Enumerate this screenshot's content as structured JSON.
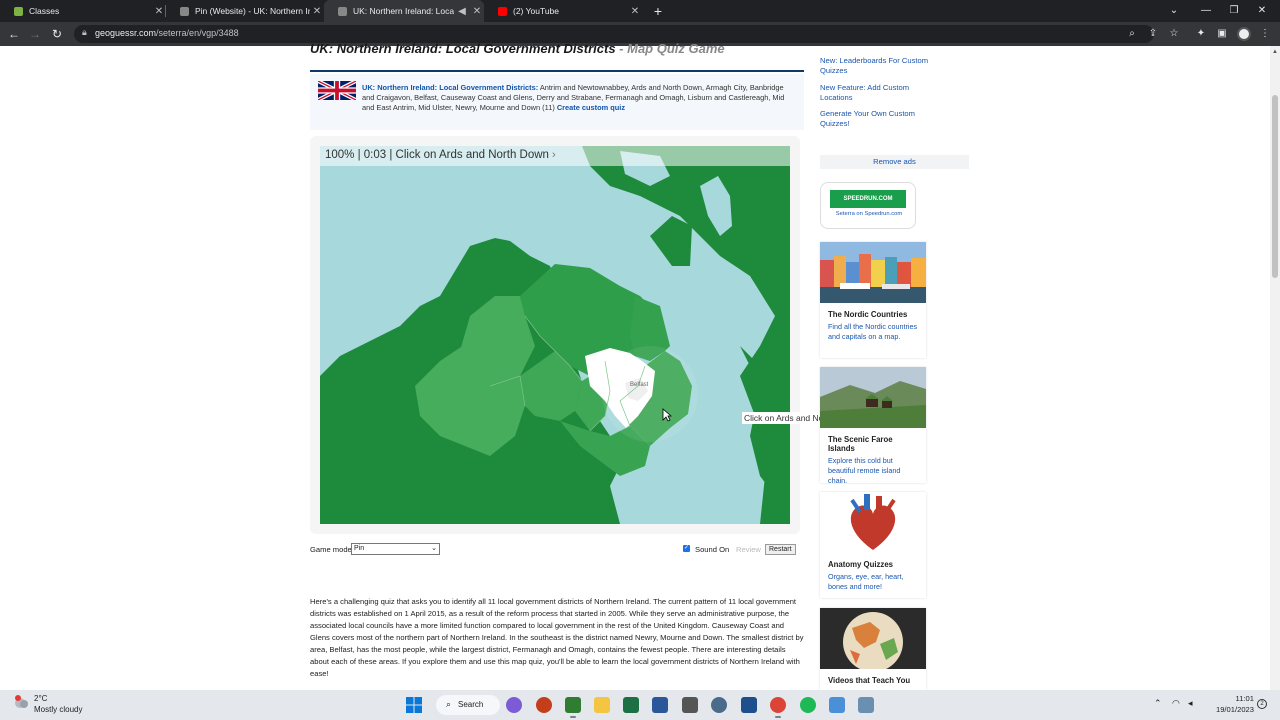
{
  "browser": {
    "tabs": [
      {
        "title": "Classes",
        "favicon_color": "#7cb342"
      },
      {
        "title": "Pin (Website) - UK: Northern Irel...",
        "favicon_color": "#888888"
      },
      {
        "title": "UK: Northern Ireland: Local G...",
        "favicon_color": "#888888"
      },
      {
        "title": "(2) YouTube",
        "favicon_color": "#ff0000"
      }
    ],
    "url_host": "geoguessr.com",
    "url_path": "/seterra/en/vgp/3488"
  },
  "page": {
    "title": "UK: Northern Ireland: Local Government Districts",
    "title_suffix": " - Map Quiz Game",
    "info_link": "UK: Northern Ireland: Local Government Districts:",
    "info_text": " Antrim and Newtownabbey, Ards and North Down, Armagh City, Banbridge and Craigavon, Belfast, Causeway Coast and Glens, Derry and Strabane, Fermanagh and Omagh, Lisburn and Castlereagh, Mid and East Antrim, Mid Ulster, Newry, Mourne and Down (11)",
    "create_link": "Create custom quiz"
  },
  "game": {
    "status": "100% | 0:03 | Click on Ards and North Down",
    "chevron": "›",
    "map_label_belfast": "Belfast",
    "hint": "Click on Ards and North Down",
    "mode_label": "Game mode:",
    "mode_value": "Pin",
    "sound_label": "Sound On",
    "review_label": "Review",
    "restart_label": "Restart",
    "progress_percent": 100
  },
  "description": "Here's a challenging quiz that asks you to identify all 11 local government districts of Northern Ireland. The current pattern of 11 local government districts was established on 1 April 2015, as a result of the reform process that started in 2005. While they serve an administrative purpose, the associated local councils have a more limited function compared to local government in the rest of the United Kingdom. Causeway Coast and Glens covers most of the northern part of Northern Ireland. In the southeast is the district named Newry, Mourne and Down. The smallest district by area, Belfast, has the most people, while the largest district, Fermanagh and Omagh, contains the fewest people. There are interesting details about each of these areas. If you explore them and use this map quiz, you'll be able to learn the local government districts of Northern Ireland with ease!",
  "sidebar": {
    "links": [
      "New: Leaderboards For Custom Quizzes",
      "New Feature: Add Custom Locations",
      "Generate Your Own Custom Quizzes!"
    ],
    "remove_ads": "Remove ads",
    "speedrun_logo": "SPEEDRUN.COM",
    "speedrun_caption": "Seterra on Speedrun.com",
    "cards": [
      {
        "title": "The Nordic Countries",
        "desc": "Find all the Nordic countries and capitals on a map."
      },
      {
        "title": "The Scenic Faroe Islands",
        "desc": "Explore this cold but beautiful remote island chain."
      },
      {
        "title": "Anatomy Quizzes",
        "desc": "Organs, eye, ear, heart, bones and more!"
      },
      {
        "title": "Videos that Teach You",
        "desc": ""
      }
    ]
  },
  "taskbar": {
    "temp": "2°C",
    "weather": "Mostly cloudy",
    "search": "Search",
    "time": "11:01",
    "date": "19/01/2023"
  },
  "colors": {
    "land_dark": "#1e8a3c",
    "land_mid": "#2f9e4a",
    "land_light": "#46ad5c",
    "sea": "#a7d8dc",
    "highlight": "#ffffff",
    "link": "#1a56b0",
    "title_rule": "#10386b"
  }
}
